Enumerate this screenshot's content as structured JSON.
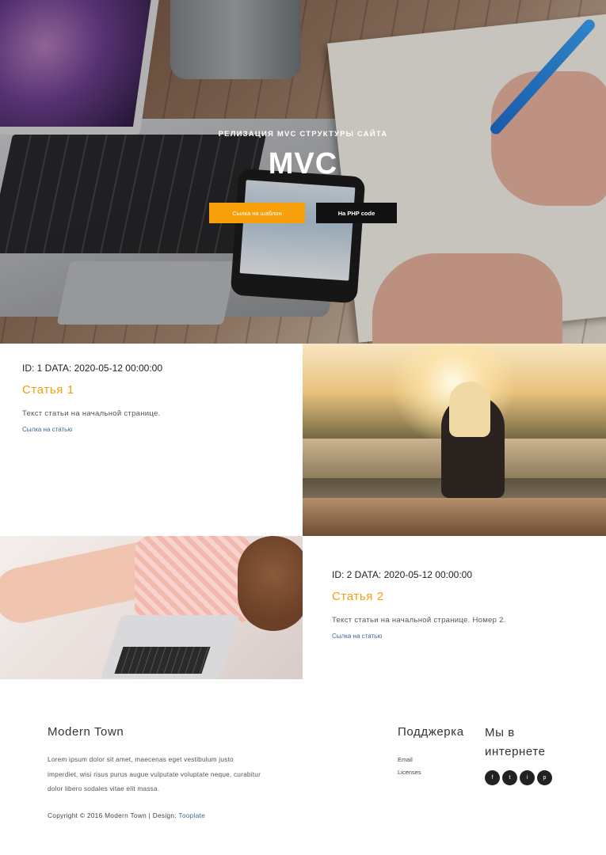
{
  "hero": {
    "subtitle": "РЕЛИЗАЦИЯ MVC СТРУКТУРЫ САЙТА",
    "title": "MVC",
    "btn_template": "Сылка на шаблон",
    "btn_php": "На PHP code"
  },
  "articles": [
    {
      "meta": "ID: 1 DATA: 2020-05-12 00:00:00",
      "title": "Статья 1",
      "body": "Текст статьи на начальной странице.",
      "link": "Сылка на статью"
    },
    {
      "meta": "ID: 2 DATA: 2020-05-12 00:00:00",
      "title": "Статья 2",
      "body": "Текст статьи на начальной странице. Номер 2.",
      "link": "Сылка на статью"
    }
  ],
  "footer": {
    "brand": "Modern Town",
    "lorem": "Lorem ipsum dolor sit amet, maecenas eget vestibulum justo imperdiet, wisi risus purus augue vulputate voluptate neque, curabitur dolor libero sodales vitae elit massa.",
    "copyright_prefix": "Copyright © 2016 Modern Town | Design: ",
    "copyright_link": "Tooplate",
    "support_title": "Подджерка",
    "support_links": [
      "Email",
      "Licenses"
    ],
    "web_title": "Мы в интернете",
    "social_icons": [
      {
        "name": "facebook-icon",
        "glyph": "f"
      },
      {
        "name": "twitter-icon",
        "glyph": "t"
      },
      {
        "name": "instagram-icon",
        "glyph": "i"
      },
      {
        "name": "pinterest-icon",
        "glyph": "p"
      }
    ]
  },
  "colors": {
    "accent": "#f7a00b",
    "article_title": "#f5a00a",
    "link": "#3a6a9a",
    "dark_button": "#111111"
  }
}
